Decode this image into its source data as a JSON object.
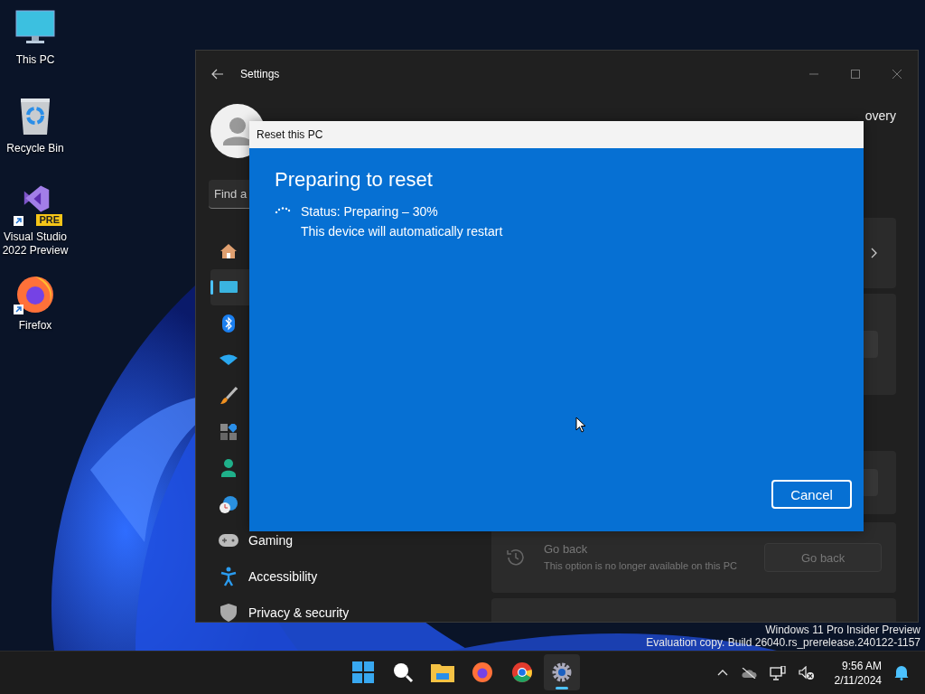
{
  "desktop": {
    "icons": [
      {
        "kind": "pc",
        "label": "This PC",
        "shortcut": false
      },
      {
        "kind": "recycle",
        "label": "Recycle Bin",
        "shortcut": false
      },
      {
        "kind": "vs",
        "label": "Visual Studio 2022 Preview",
        "badge": "PRE",
        "shortcut": true
      },
      {
        "kind": "firefox",
        "label": "Firefox",
        "shortcut": true
      }
    ],
    "watermark": [
      "Windows 11 Pro Insider Preview",
      "Evaluation copy. Build 26040.rs_prerelease.240122-1157"
    ]
  },
  "settings": {
    "title": "Settings",
    "search": {
      "placeholder": "Find a"
    },
    "nav": [
      {
        "kind": "home",
        "selected": false
      },
      {
        "kind": "system",
        "selected": true
      },
      {
        "kind": "bluetooth",
        "selected": false
      },
      {
        "kind": "network",
        "selected": false
      },
      {
        "kind": "personalization",
        "selected": false
      },
      {
        "kind": "apps",
        "selected": false
      },
      {
        "kind": "accounts",
        "selected": false
      },
      {
        "kind": "time",
        "selected": false
      },
      {
        "kind": "gaming",
        "label": "Gaming",
        "selected": false
      },
      {
        "kind": "accessibility",
        "label": "Accessibility",
        "selected": false
      },
      {
        "kind": "privacy",
        "label": "Privacy & security",
        "selected": false
      }
    ],
    "header_fragment": "overy",
    "go_back": {
      "title": "Go back",
      "description": "This option is no longer available on this PC",
      "button": "Go back",
      "disabled": true
    }
  },
  "dialog": {
    "title": "Reset this PC",
    "heading": "Preparing to reset",
    "status": "Status: Preparing – 30%",
    "note": "This device will automatically restart",
    "buttons": [
      "Cancel"
    ]
  },
  "taskbar": {
    "apps": [
      {
        "kind": "start",
        "active": false
      },
      {
        "kind": "search",
        "active": false
      },
      {
        "kind": "explorer",
        "active": false
      },
      {
        "kind": "firefox",
        "active": false
      },
      {
        "kind": "chrome",
        "active": false
      },
      {
        "kind": "settings",
        "active": true
      }
    ],
    "time": "9:56 AM",
    "date": "2/11/2024"
  }
}
